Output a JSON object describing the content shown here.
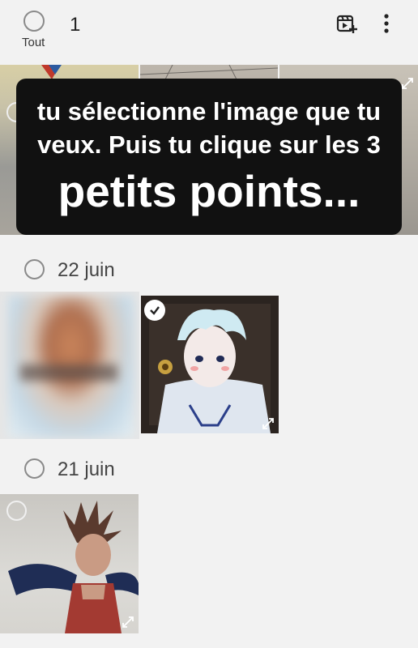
{
  "header": {
    "selected_count": "1",
    "select_all_label": "Tout",
    "icons": [
      "create-video-icon",
      "more-options-icon"
    ]
  },
  "caption": {
    "line1": "tu sélectionne l'image que tu",
    "line2": "veux. Puis tu clique sur les 3",
    "line3": "petits points..."
  },
  "groups": [
    {
      "date": "22 juin",
      "photos": [
        "blurred-portrait",
        "anime-boy-drawing"
      ],
      "selected": [
        false,
        true
      ]
    },
    {
      "date": "21 juin",
      "photos": [
        "winged-character-drawing"
      ],
      "selected": [
        false
      ]
    }
  ],
  "colors": {
    "background": "#f2f2f2",
    "caption_bg": "#111111",
    "checkmark_bg": "#ffffff"
  }
}
